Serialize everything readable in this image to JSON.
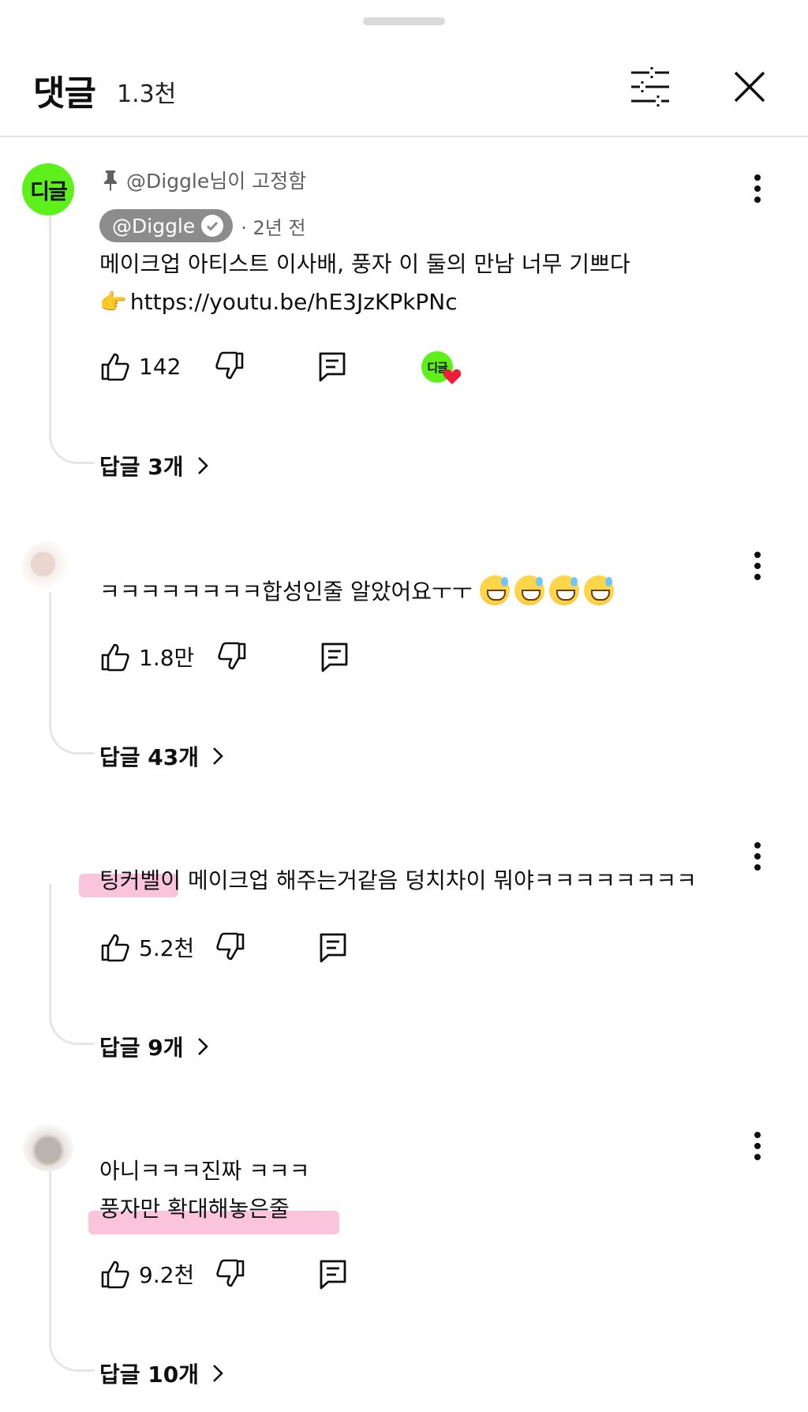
{
  "header": {
    "title": "댓글",
    "count": "1.3천"
  },
  "comments": [
    {
      "pinned_label": "@Diggle님이 고정함",
      "avatar_text": "디글",
      "author": "@Diggle",
      "time": "2년 전",
      "lines": [
        "메이크업 아티스트 이사배, 풍자 이 둘의 만남 너무 기쁘다",
        "https://youtu.be/hE3JzKPkPNc"
      ],
      "likes": "142",
      "hearted_avatar_text": "디글",
      "replies": "답글 3개"
    },
    {
      "lines": [
        "ㅋㅋㅋㅋㅋㅋㅋㅋ합성인줄 알았어요ㅜㅜ"
      ],
      "likes": "1.8만",
      "replies": "답글 43개"
    },
    {
      "lines": [
        "팅커벨이 메이크업 해주는거같음 덩치차이 뭐야ㅋㅋㅋㅋㅋㅋㅋㅋ"
      ],
      "likes": "5.2천",
      "replies": "답글 9개"
    },
    {
      "lines": [
        "아니ㅋㅋㅋ진짜 ㅋㅋㅋ",
        "풍자만 확대해놓은줄"
      ],
      "likes": "9.2천",
      "replies": "답글 10개"
    }
  ],
  "colors": {
    "accent_green": "#5ef01a",
    "highlight_pink": "#f696be",
    "secondary_text": "#606060"
  }
}
